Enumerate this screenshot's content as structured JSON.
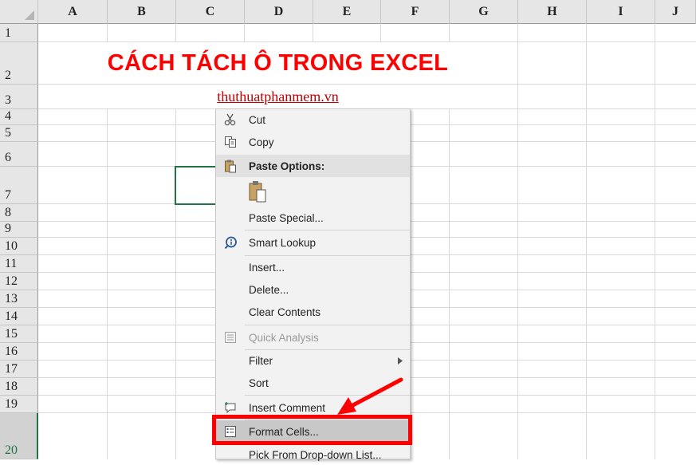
{
  "corner_icon": "select-all-triangle-icon",
  "columns": [
    "A",
    "B",
    "C",
    "D",
    "E",
    "F",
    "G",
    "H",
    "I",
    "J"
  ],
  "rows": [
    "1",
    "2",
    "3",
    "4",
    "5",
    "6",
    "7",
    "8",
    "9",
    "10",
    "11",
    "12",
    "13",
    "14",
    "15",
    "16",
    "17",
    "18",
    "19",
    "20"
  ],
  "selected_row": "20",
  "cells": {
    "title": "CÁCH TÁCH Ô TRONG EXCEL",
    "subtitle_link": "thuthuatphanmem.vn"
  },
  "context_menu": {
    "items": [
      {
        "key": "cut",
        "label": "Cut",
        "icon": "scissors-icon"
      },
      {
        "key": "copy",
        "label": "Copy",
        "icon": "copy-icon"
      },
      {
        "key": "paste_options",
        "label": "Paste Options:",
        "icon": "clipboard-icon"
      },
      {
        "key": "paste_special",
        "label": "Paste Special..."
      },
      {
        "key": "smart_lookup",
        "label": "Smart Lookup",
        "icon": "smart-lookup-icon"
      },
      {
        "key": "insert",
        "label": "Insert..."
      },
      {
        "key": "delete",
        "label": "Delete..."
      },
      {
        "key": "clear_contents",
        "label": "Clear Contents"
      },
      {
        "key": "quick_analysis",
        "label": "Quick Analysis",
        "icon": "quick-analysis-icon"
      },
      {
        "key": "filter",
        "label": "Filter",
        "icon": "chevron-right-icon"
      },
      {
        "key": "sort",
        "label": "Sort"
      },
      {
        "key": "insert_comment",
        "label": "Insert Comment",
        "icon": "comment-icon"
      },
      {
        "key": "format_cells",
        "label": "Format Cells...",
        "icon": "format-cells-icon"
      },
      {
        "key": "pick_from_list",
        "label": "Pick From Drop-down List..."
      }
    ]
  },
  "colors": {
    "accent_green": "#217346",
    "title_red": "#ff0000",
    "highlight_red": "#ff0000",
    "link_red": "#c00000"
  }
}
